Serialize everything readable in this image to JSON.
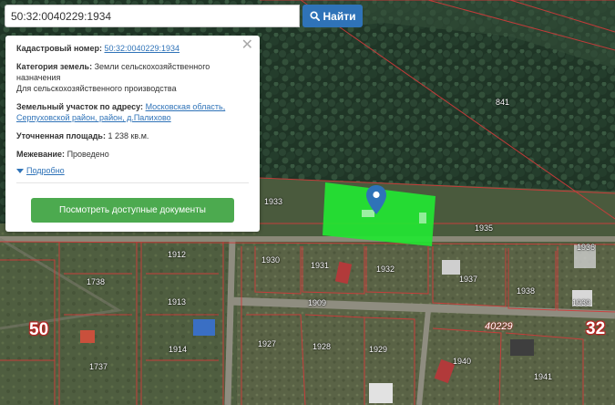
{
  "search": {
    "value": "50:32:0040229:1934",
    "button_label": "Найти"
  },
  "info": {
    "cadastral_label": "Кадастровый номер:",
    "cadastral_value": "50:32:0040229:1934",
    "category_label": "Категория земель:",
    "category_value": "Земли сельскохозяйственного назначения",
    "usage_value": "Для сельскохозяйственного производства",
    "address_label": "Земельный участок по адресу:",
    "address_value": "Московская область, Серпуховской район, район, д.Палихово",
    "area_label": "Уточненная площадь:",
    "area_value": "1 238 кв.м.",
    "survey_label": "Межевание:",
    "survey_value": "Проведено",
    "details_label": "Подробно",
    "docs_button_label": "Посмотреть доступные документы"
  },
  "map": {
    "parcels": [
      "841",
      "1933",
      "1935",
      "1936",
      "1930",
      "1931",
      "1932",
      "1937",
      "1938",
      "1939",
      "1912",
      "1738",
      "1913",
      "1909",
      "1737",
      "1914",
      "1927",
      "1928",
      "1929",
      "1940",
      "1941"
    ],
    "quarter_labels": [
      "50",
      "32"
    ],
    "block_label": "40229",
    "highlight_color": "#22e632",
    "marker_color": "#2f73b8"
  }
}
